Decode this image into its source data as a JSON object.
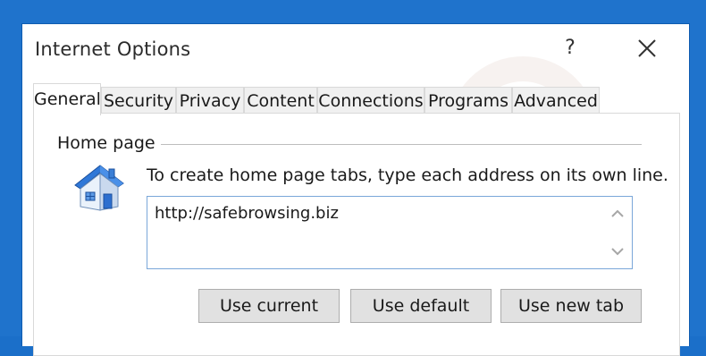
{
  "window": {
    "title": "Internet Options",
    "help_label": "?"
  },
  "tabs": [
    {
      "label": "General",
      "active": true
    },
    {
      "label": "Security",
      "active": false
    },
    {
      "label": "Privacy",
      "active": false
    },
    {
      "label": "Content",
      "active": false
    },
    {
      "label": "Connections",
      "active": false
    },
    {
      "label": "Programs",
      "active": false
    },
    {
      "label": "Advanced",
      "active": false
    }
  ],
  "home_page": {
    "group_label": "Home page",
    "description": "To create home page tabs, type each address on its own line.",
    "address_value": "http://safebrowsing.biz",
    "buttons": {
      "use_current": "Use current",
      "use_default": "Use default",
      "use_new_tab": "Use new tab"
    }
  },
  "icons": {
    "house": "home-page-icon",
    "close": "close-icon",
    "scroll_up": "scroll-up-icon",
    "scroll_down": "scroll-down-icon"
  },
  "colors": {
    "frame_blue": "#1f73cc",
    "active_border": "#7aa7d9",
    "button_bg": "#e1e1e1",
    "tab_bg": "#f0f0f0"
  }
}
